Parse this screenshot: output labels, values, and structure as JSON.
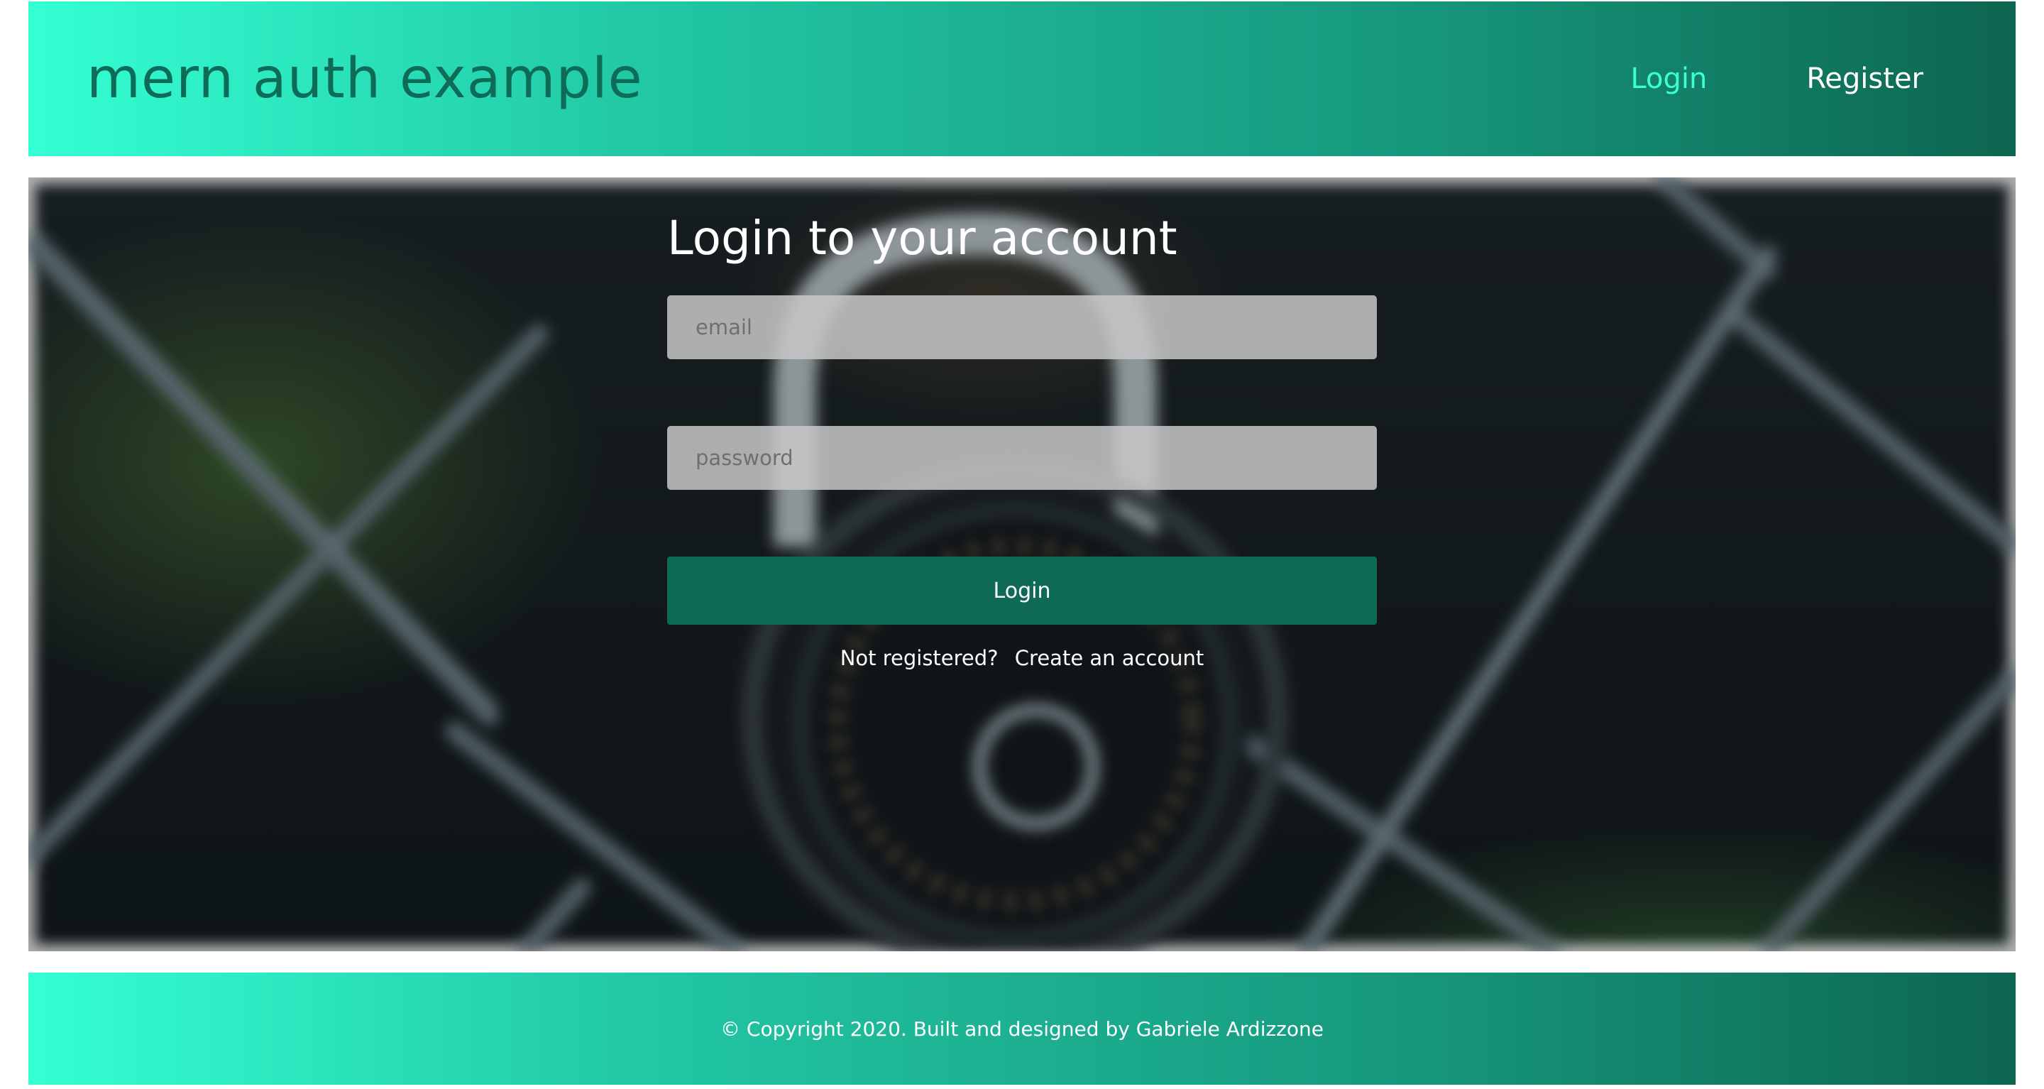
{
  "header": {
    "brand": "mern auth example",
    "nav": {
      "login": "Login",
      "register": "Register"
    }
  },
  "login_form": {
    "title": "Login to your account",
    "email_placeholder": "email",
    "password_placeholder": "password",
    "submit_label": "Login",
    "not_registered": "Not registered?",
    "create_account": "Create an account"
  },
  "footer": {
    "text": "© Copyright 2020. Built and designed by Gabriele Ardizzone"
  },
  "colors": {
    "accent_light": "#34ffd3",
    "accent_dark": "#0d6650",
    "button": "#0e6a57",
    "active_nav": "#3affd6"
  },
  "background_image": {
    "icon": "padlock-behind-chain-fence"
  }
}
